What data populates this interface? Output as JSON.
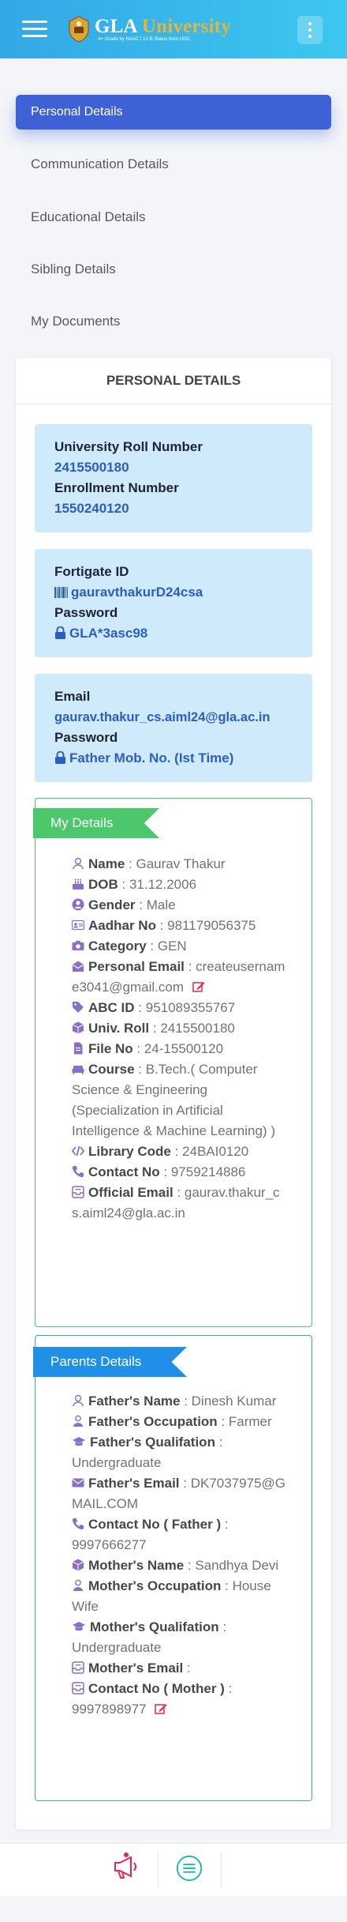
{
  "header": {
    "logo_text_main": "GLA",
    "logo_text_accent": "University",
    "logo_subtitle": "A+ Grade by NAAC | 12-B Status from UGC",
    "icons": {
      "menu": "hamburger-icon",
      "more": "vertical-dots-icon"
    },
    "brand_color": "#3cb8ea"
  },
  "nav": {
    "items": [
      {
        "label": "Personal Details",
        "active": true
      },
      {
        "label": "Communication Details",
        "active": false
      },
      {
        "label": "Educational Details",
        "active": false
      },
      {
        "label": "Sibling Details",
        "active": false
      },
      {
        "label": "My Documents",
        "active": false
      }
    ]
  },
  "card": {
    "title": "PERSONAL DETAILS",
    "university_block": {
      "roll_label": "University Roll Number",
      "roll_value": "2415500180",
      "enrollment_label": "Enrollment Number",
      "enrollment_value": "1550240120"
    },
    "fortigate_block": {
      "id_label": "Fortigate ID",
      "id_value": "gauravthakurD24csa",
      "password_label": "Password",
      "password_value": "GLA*3asc98"
    },
    "email_block": {
      "email_label": "Email",
      "email_value": "gaurav.thakur_cs.aiml24@gla.ac.in",
      "password_label": "Password",
      "password_value": "Father Mob. No. (Ist Time)"
    },
    "my_details": {
      "title": "My Details",
      "name_label": "Name",
      "name_value": "Gaurav Thakur",
      "dob_label": "DOB",
      "dob_value": "31.12.2006",
      "gender_label": "Gender",
      "gender_value": "Male",
      "aadhar_label": "Aadhar No",
      "aadhar_value": "981179056375",
      "category_label": "Category",
      "category_value": "GEN",
      "personal_email_label": "Personal Email",
      "personal_email_value": "createusername3041@gmail.com",
      "abc_label": "ABC ID",
      "abc_value": "951089355767",
      "univ_roll_label": "Univ. Roll",
      "univ_roll_value": "2415500180",
      "file_label": "File No",
      "file_value": "24-15500120",
      "course_label": "Course",
      "course_value": "B.Tech.( Computer Science & Engineering (Specialization in Artificial Intelligence & Machine Learning) )",
      "library_label": "Library Code",
      "library_value": "24BAI0120",
      "contact_label": "Contact No",
      "contact_value": "9759214886",
      "official_email_label": "Official Email",
      "official_email_value": "gaurav.thakur_cs.aiml24@gla.ac.in"
    },
    "parents": {
      "title": "Parents Details",
      "father_name_label": "Father's Name",
      "father_name_value": "Dinesh Kumar",
      "father_occ_label": "Father's Occupation",
      "father_occ_value": "Farmer",
      "father_qual_label": "Father's Qualifation",
      "father_qual_value": "Undergraduate",
      "father_email_label": "Father's Email",
      "father_email_value": "DK7037975@GMAIL.COM",
      "father_contact_label": "Contact No ( Father )",
      "father_contact_value": "9997666277",
      "mother_name_label": "Mother's Name",
      "mother_name_value": "Sandhya Devi",
      "mother_occ_label": "Mother's Occupation",
      "mother_occ_value": "House Wife",
      "mother_qual_label": "Mother's Qualifation",
      "mother_qual_value": "Undergraduate",
      "mother_email_label": "Mother's Email",
      "mother_email_value": "",
      "mother_contact_label": "Contact No ( Mother )",
      "mother_contact_value": "9997898977"
    }
  },
  "bottom": {
    "icons": [
      "megaphone-icon",
      "menu-circle-icon"
    ]
  },
  "colors": {
    "active_nav": "#3f61d6",
    "info_bg": "#cfeafb",
    "my_details_accent": "#4cc76b",
    "parents_accent": "#1f8fe8",
    "edit_icon": "#e8245a"
  }
}
